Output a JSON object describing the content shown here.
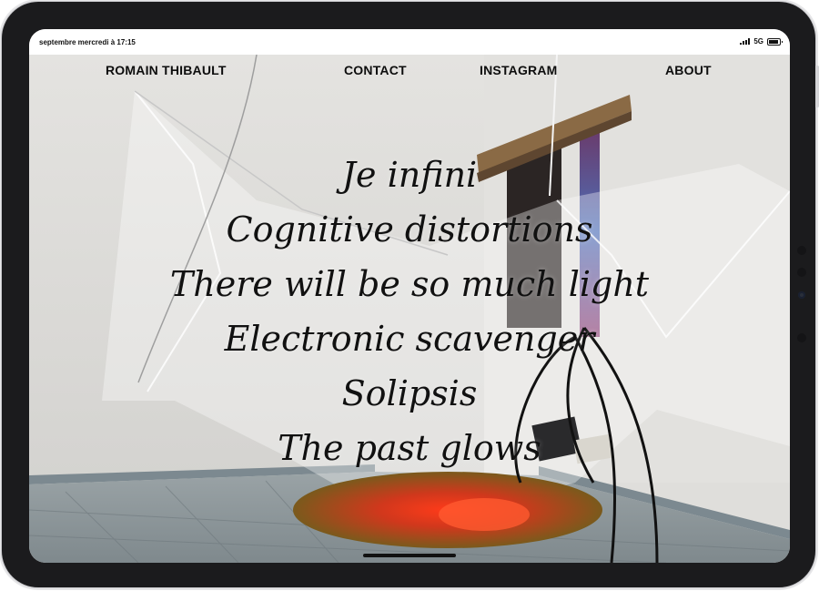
{
  "status_bar": {
    "time": "septembre mercredi à 17:15",
    "network": "5G"
  },
  "nav": {
    "name": "ROMAIN THIBAULT",
    "contact": "CONTACT",
    "instagram": "INSTAGRAM",
    "about": "ABOUT"
  },
  "works": [
    "Je infini",
    "Cognitive distortions",
    "There will be so much light",
    "Electronic scavenger",
    "Solipsis",
    "The past glows"
  ],
  "colors": {
    "device_frame": "#1b1b1d",
    "wall": "#dfdedb",
    "floor": "#8f999e",
    "text": "#111111"
  }
}
